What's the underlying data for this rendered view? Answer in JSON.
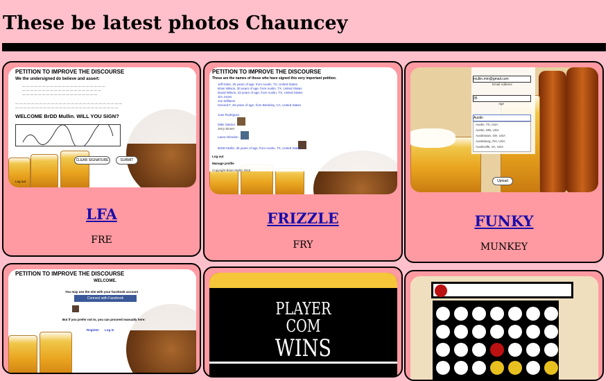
{
  "page": {
    "title": "These be latest photos Chauncey"
  },
  "colors": {
    "background": "#ffc0cb",
    "card": "#ff9aa2",
    "link": "#1a0dab"
  },
  "cards": [
    {
      "link": "LFA",
      "caption": "FRE",
      "shot": {
        "heading": "PETITION TO IMPROVE THE DISCOURSE",
        "subheading": "We the undersigned do believe and assert:",
        "welcome": "WELCOME BrDD Mullin. WILL YOU SIGN?",
        "clear_btn": "CLEAR SIGNATURE",
        "submit_btn": "SUBMIT",
        "footer": "Log out"
      }
    },
    {
      "link": "FRIZZLE",
      "caption": "FRY",
      "shot": {
        "heading": "PETITION TO IMPROVE THE DISCOURSE",
        "subheading": "These are the names of those who have signed this very important petition.",
        "names": [
          "Jeff Doke, 25 years of age, from Austin, TX, United States",
          "Brian Wilson, 30 years of age, from Austin, TX, United States",
          "David Wilson, 33 years of age, from Austin, TX, United States",
          "Jim Jones",
          "Jon Williams",
          "Gerund F, 48 years of age, from Berkeley, CA, United States",
          "Jose Rodriguez",
          "Mike Stamer",
          "Jerry Sinner",
          "Laura Glendon",
          "BrDD Mullin, 35 years of age, from Austin, TX, United States"
        ],
        "logout": "Log out",
        "manage": "Manage profile",
        "copyright": "Copyright Brian Mullin 2016"
      }
    },
    {
      "link": "FUNKY",
      "caption": "MUNKEY",
      "shot": {
        "email_value": "mullin.mm@gmail.com",
        "email_label": "Email Address",
        "age_value": "35",
        "age_label": "Age",
        "city_value": "Austin",
        "suggestions": [
          "Austin, TX, USA",
          "Austin, MN, USA",
          "Austintown, OH, USA",
          "Austinburg, OH, USA",
          "Austinville, VA, USA"
        ],
        "button": "Upload"
      }
    },
    {
      "link": "",
      "caption": "",
      "shot": {
        "heading": "PETITION TO IMPROVE THE DISCOURSE",
        "welcome": "WELCOME.",
        "fb_text": "You may use the site with your facebook account",
        "fb_button": "Connect with Facebook",
        "manual_text": "But if you prefer not to, you can proceed manually here:",
        "register": "Register",
        "login": "Log In"
      }
    },
    {
      "link": "",
      "caption": "",
      "shot": {
        "line1": "PLAYER",
        "line2": "COM",
        "line3": "WINS"
      }
    },
    {
      "link": "",
      "caption": "",
      "shot": {
        "game": "connect-four"
      }
    }
  ]
}
